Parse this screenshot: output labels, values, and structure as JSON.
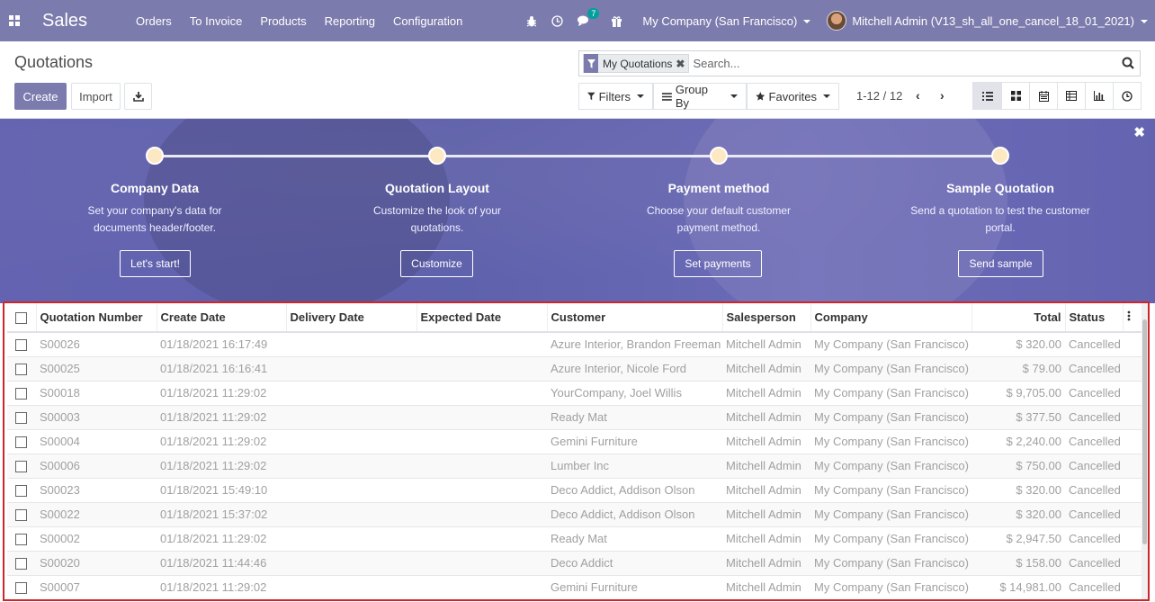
{
  "navbar": {
    "app_name": "Sales",
    "menu": [
      "Orders",
      "To Invoice",
      "Products",
      "Reporting",
      "Configuration"
    ],
    "chat_badge": "7",
    "company": "My Company (San Francisco)",
    "user": "Mitchell Admin (V13_sh_all_one_cancel_18_01_2021)",
    "colors": {
      "brand": "#7c7bad"
    }
  },
  "control": {
    "breadcrumb": "Quotations",
    "create_label": "Create",
    "import_label": "Import",
    "facet_label": "My Quotations",
    "search_placeholder": "Search...",
    "filters_label": "Filters",
    "groupby_label": "Group By",
    "favorites_label": "Favorites",
    "pager": "1-12 / 12",
    "views": [
      "list-icon",
      "kanban-icon",
      "calendar-icon",
      "pivot-icon",
      "graph-icon",
      "activity-icon"
    ]
  },
  "banner": {
    "steps": [
      {
        "title": "Company Data",
        "desc": "Set your company's data for documents header/footer.",
        "button": "Let's start!"
      },
      {
        "title": "Quotation Layout",
        "desc": "Customize the look of your quotations.",
        "button": "Customize"
      },
      {
        "title": "Payment method",
        "desc": "Choose your default customer payment method.",
        "button": "Set payments"
      },
      {
        "title": "Sample Quotation",
        "desc": "Send a quotation to test the customer portal.",
        "button": "Send sample"
      }
    ]
  },
  "table": {
    "columns": [
      "Quotation Number",
      "Create Date",
      "Delivery Date",
      "Expected Date",
      "Customer",
      "Salesperson",
      "Company",
      "Total",
      "Status"
    ],
    "rows": [
      [
        "S00026",
        "01/18/2021 16:17:49",
        "",
        "",
        "Azure Interior, Brandon Freeman",
        "Mitchell Admin",
        "My Company (San Francisco)",
        "$ 320.00",
        "Cancelled"
      ],
      [
        "S00025",
        "01/18/2021 16:16:41",
        "",
        "",
        "Azure Interior, Nicole Ford",
        "Mitchell Admin",
        "My Company (San Francisco)",
        "$ 79.00",
        "Cancelled"
      ],
      [
        "S00018",
        "01/18/2021 11:29:02",
        "",
        "",
        "YourCompany, Joel Willis",
        "Mitchell Admin",
        "My Company (San Francisco)",
        "$ 9,705.00",
        "Cancelled"
      ],
      [
        "S00003",
        "01/18/2021 11:29:02",
        "",
        "",
        "Ready Mat",
        "Mitchell Admin",
        "My Company (San Francisco)",
        "$ 377.50",
        "Cancelled"
      ],
      [
        "S00004",
        "01/18/2021 11:29:02",
        "",
        "",
        "Gemini Furniture",
        "Mitchell Admin",
        "My Company (San Francisco)",
        "$ 2,240.00",
        "Cancelled"
      ],
      [
        "S00006",
        "01/18/2021 11:29:02",
        "",
        "",
        "Lumber Inc",
        "Mitchell Admin",
        "My Company (San Francisco)",
        "$ 750.00",
        "Cancelled"
      ],
      [
        "S00023",
        "01/18/2021 15:49:10",
        "",
        "",
        "Deco Addict, Addison Olson",
        "Mitchell Admin",
        "My Company (San Francisco)",
        "$ 320.00",
        "Cancelled"
      ],
      [
        "S00022",
        "01/18/2021 15:37:02",
        "",
        "",
        "Deco Addict, Addison Olson",
        "Mitchell Admin",
        "My Company (San Francisco)",
        "$ 320.00",
        "Cancelled"
      ],
      [
        "S00002",
        "01/18/2021 11:29:02",
        "",
        "",
        "Ready Mat",
        "Mitchell Admin",
        "My Company (San Francisco)",
        "$ 2,947.50",
        "Cancelled"
      ],
      [
        "S00020",
        "01/18/2021 11:44:46",
        "",
        "",
        "Deco Addict",
        "Mitchell Admin",
        "My Company (San Francisco)",
        "$ 158.00",
        "Cancelled"
      ],
      [
        "S00007",
        "01/18/2021 11:29:02",
        "",
        "",
        "Gemini Furniture",
        "Mitchell Admin",
        "My Company (San Francisco)",
        "$ 14,981.00",
        "Cancelled"
      ]
    ]
  }
}
